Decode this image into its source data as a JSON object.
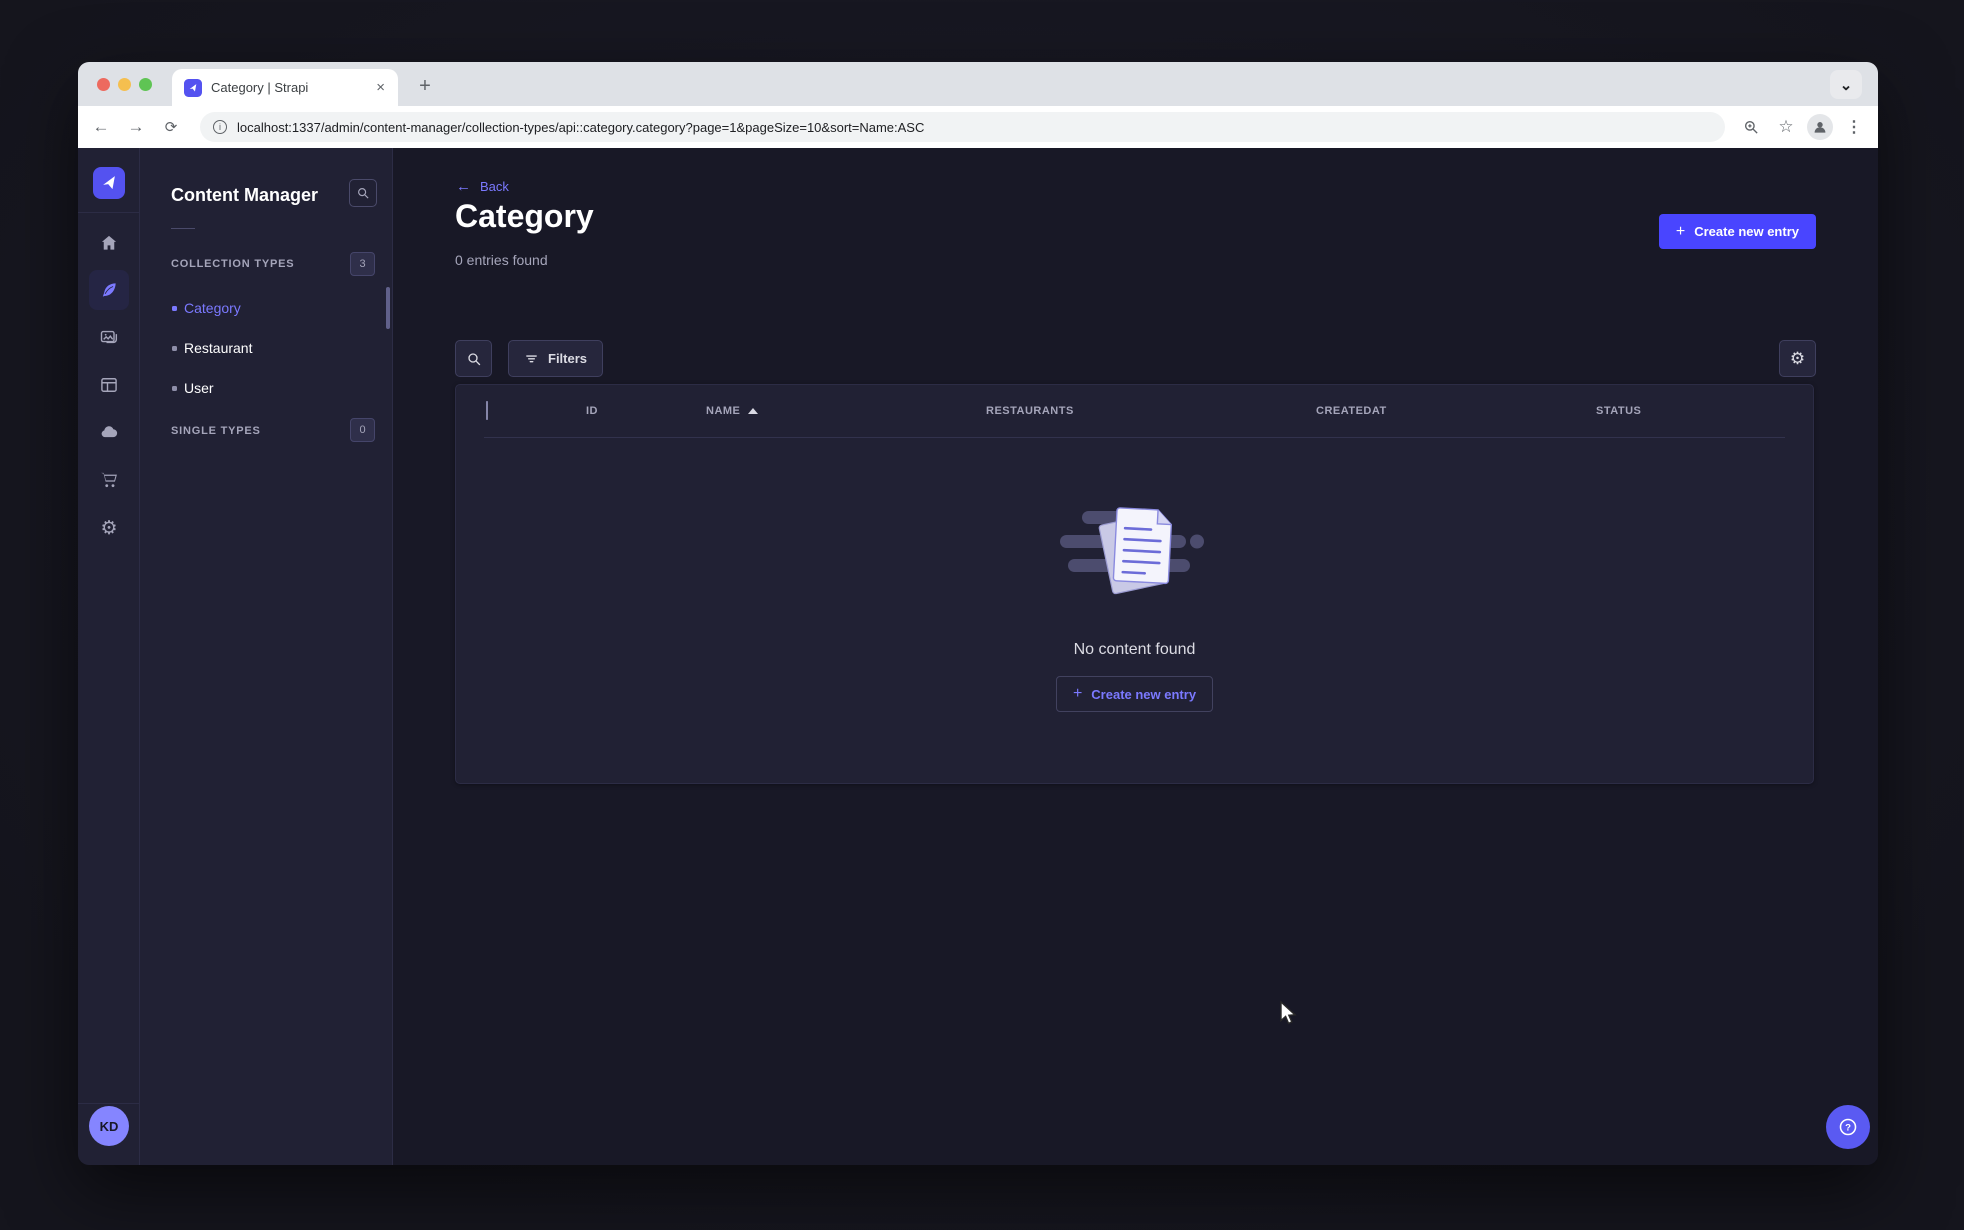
{
  "browser": {
    "tab_title": "Category | Strapi",
    "url": "localhost:1337/admin/content-manager/collection-types/api::category.category?page=1&pageSize=10&sort=Name:ASC"
  },
  "icons": {
    "close_tab": "×",
    "new_tab": "+",
    "tabstrip_chevron": "⌄",
    "nav_back": "←",
    "nav_forward": "→",
    "nav_reload": "⟳",
    "info": "i",
    "star": "☆",
    "overflow_menu": "⋮",
    "gear": "⚙",
    "plus": "+",
    "back_arrow": "←"
  },
  "sidebar": {
    "avatar_initials": "KD"
  },
  "subnav": {
    "title": "Content Manager",
    "sections": [
      {
        "label": "COLLECTION TYPES",
        "badge": "3",
        "items": [
          {
            "label": "Category"
          },
          {
            "label": "Restaurant"
          },
          {
            "label": "User"
          }
        ]
      },
      {
        "label": "SINGLE TYPES",
        "badge": "0",
        "items": []
      }
    ]
  },
  "main": {
    "back_label": "Back",
    "page_title": "Category",
    "entries_summary": "0 entries found",
    "create_button_label": "Create new entry",
    "filters_label": "Filters",
    "table": {
      "columns": [
        "ID",
        "NAME",
        "RESTAURANTS",
        "CREATEDAT",
        "STATUS"
      ],
      "sort_column": "NAME",
      "sort_direction": "ASC",
      "rows": []
    },
    "empty_state": {
      "message": "No content found",
      "cta_label": "Create new entry"
    }
  },
  "colors": {
    "primary": "#4945ff",
    "primary_light": "#7b79ff",
    "app_background": "#181826",
    "surface": "#212134"
  }
}
